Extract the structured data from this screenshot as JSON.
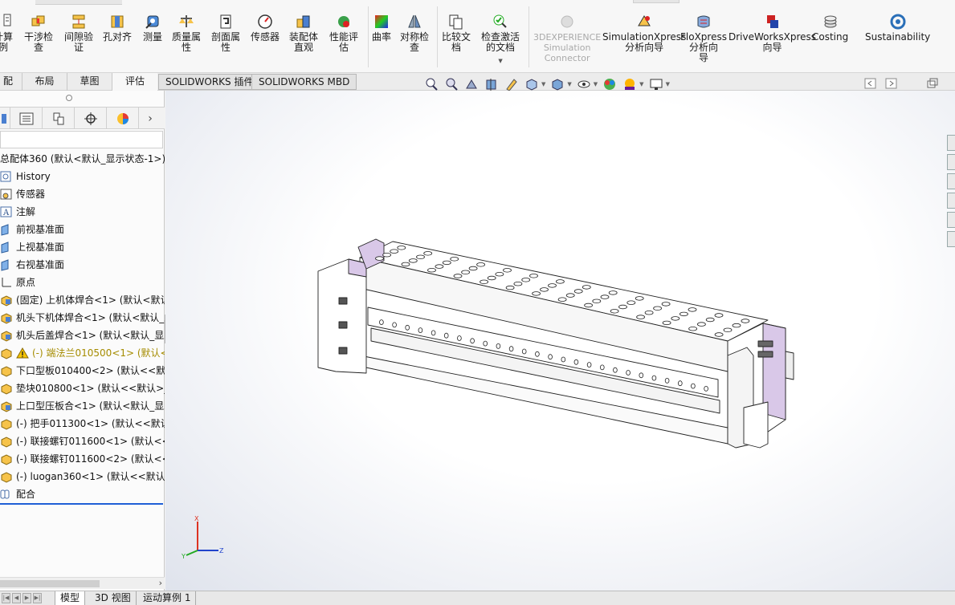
{
  "ribbon": {
    "buttons": [
      {
        "label": "计算\n例"
      },
      {
        "label": "干涉检\n查"
      },
      {
        "label": "间隙验\n证"
      },
      {
        "label": "孔对齐"
      },
      {
        "label": "测量"
      },
      {
        "label": "质量属\n性"
      },
      {
        "label": "剖面属\n性"
      },
      {
        "label": "传感器"
      },
      {
        "label": "装配体\n直观"
      },
      {
        "label": "性能评\n估"
      },
      {
        "label": "曲率"
      },
      {
        "label": "对称检\n查"
      },
      {
        "label": "比较文\n档"
      },
      {
        "label": "检查激活\n的文档"
      },
      {
        "label": "3DEXPERIENCE\nSimulation\nConnector"
      },
      {
        "label": "SimulationXpress\n分析向导"
      },
      {
        "label": "FloXpress\n分析向\n导"
      },
      {
        "label": "DriveWorksXpress\n向导"
      },
      {
        "label": "Costing"
      },
      {
        "label": "Sustainability"
      }
    ]
  },
  "command_tabs": [
    "配体",
    "布局",
    "草图",
    "评估",
    "SOLIDWORKS 插件",
    "SOLIDWORKS MBD"
  ],
  "tree": {
    "root": "总配体360  (默认<默认_显示状态-1>)",
    "items": [
      {
        "label": "History",
        "icon": "history-icon"
      },
      {
        "label": "传感器",
        "icon": "sensor-icon"
      },
      {
        "label": "注解",
        "icon": "annotation-icon"
      },
      {
        "label": "前视基准面",
        "icon": "plane-icon"
      },
      {
        "label": "上视基准面",
        "icon": "plane-icon"
      },
      {
        "label": "右视基准面",
        "icon": "plane-icon"
      },
      {
        "label": "原点",
        "icon": "origin-icon"
      },
      {
        "label": "(固定) 上机体焊合<1> (默认<默认",
        "icon": "assembly-icon"
      },
      {
        "label": "机头下机体焊合<1> (默认<默认_显",
        "icon": "assembly-icon"
      },
      {
        "label": "机头后盖焊合<1> (默认<默认_显示",
        "icon": "assembly-icon"
      },
      {
        "label": "(-) 端法兰010500<1> (默认<",
        "icon": "part-icon",
        "warn": true
      },
      {
        "label": "下口型板010400<2> (默认<<默认",
        "icon": "part-icon"
      },
      {
        "label": "垫块010800<1> (默认<<默认>_显",
        "icon": "part-icon"
      },
      {
        "label": "上口型压板合<1> (默认<默认_显示",
        "icon": "assembly-icon"
      },
      {
        "label": "(-) 把手011300<1> (默认<<默认",
        "icon": "part-icon"
      },
      {
        "label": "(-) 联接螺钉011600<1> (默认<<",
        "icon": "part-icon"
      },
      {
        "label": "(-) 联接螺钉011600<2> (默认<<",
        "icon": "part-icon"
      },
      {
        "label": "(-) luogan360<1> (默认<<默认>",
        "icon": "part-icon"
      },
      {
        "label": "配合",
        "icon": "mates-icon"
      }
    ]
  },
  "bottom_tabs": [
    "模型",
    "3D 视图",
    "运动算例 1"
  ],
  "triad": {
    "x": "X",
    "y": "Y",
    "z": "Z"
  },
  "colors": {
    "accent": "#1f5fd6",
    "model_face": "#ffffff",
    "model_accent": "#d9c8e8"
  }
}
